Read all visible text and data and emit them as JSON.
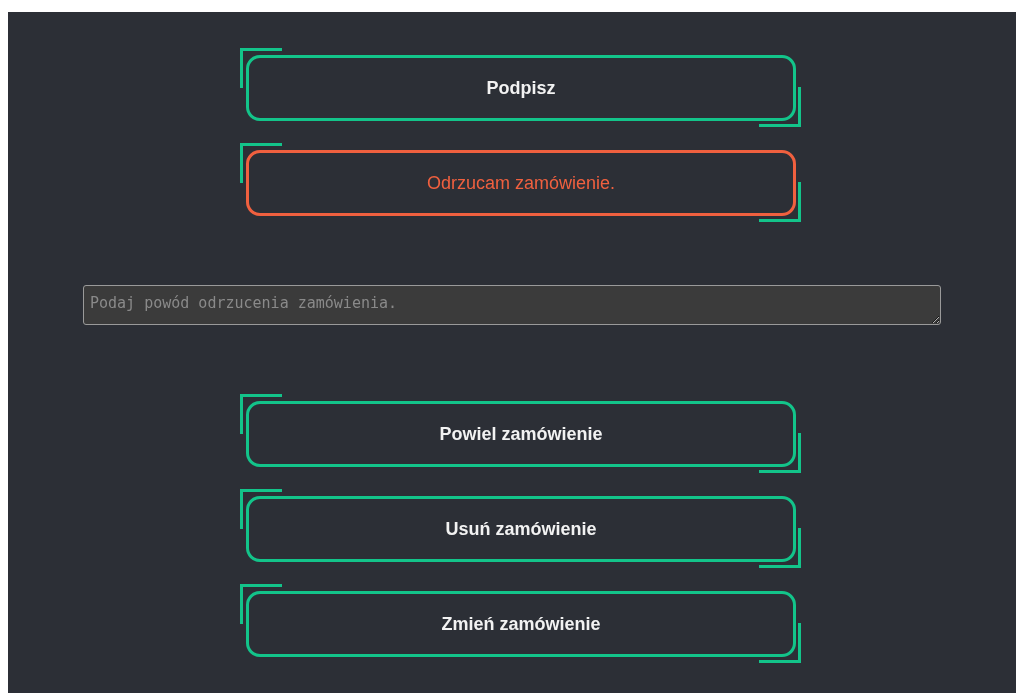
{
  "actions_top": [
    {
      "label": "Podpisz",
      "kind": "primary"
    },
    {
      "label": "Odrzucam zamówienie.",
      "kind": "danger"
    }
  ],
  "reason_field": {
    "placeholder": "Podaj powód odrzucenia zamówienia."
  },
  "actions_bottom": [
    {
      "label": "Powiel zamówienie",
      "kind": "primary"
    },
    {
      "label": "Usuń zamówienie",
      "kind": "primary"
    },
    {
      "label": "Zmień zamówienie",
      "kind": "primary"
    }
  ]
}
